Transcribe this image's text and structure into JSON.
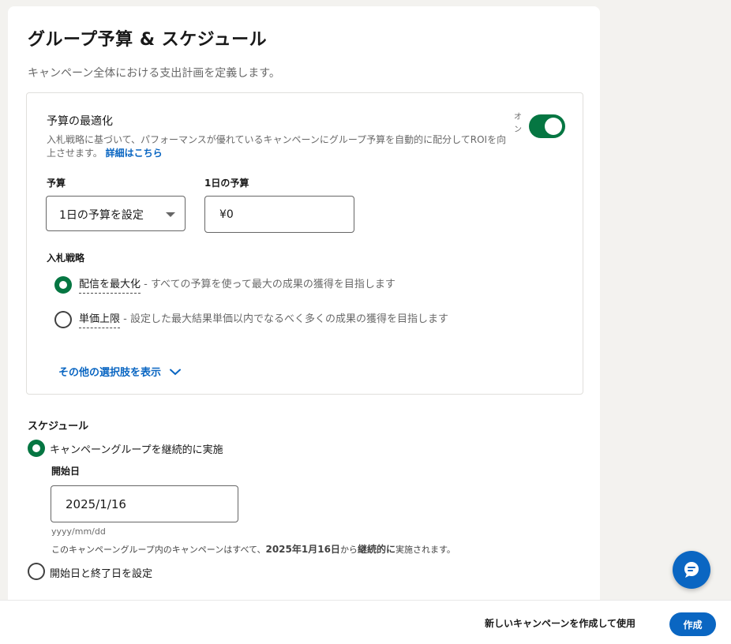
{
  "page": {
    "title": "グループ予算 & スケジュール",
    "subtitle": "キャンペーン全体における支出計画を定義します。"
  },
  "budget_optimization": {
    "heading": "予算の最適化",
    "description_line1": "入札戦略に基づいて、パフォーマンスが優れているキャンペーンにグループ予算を自動的に配分し",
    "description_line2": "てROIを向上させます。",
    "learn_more": "詳細はこちら",
    "toggle_label": "オン",
    "toggle_on": true
  },
  "budget": {
    "budget_label": "予算",
    "budget_select_value": "1日の予算を設定",
    "daily_budget_label": "1日の予算",
    "daily_budget_value": "¥0"
  },
  "bidding": {
    "label": "入札戦略",
    "options": [
      {
        "term": "配信を最大化",
        "description": " - すべての予算を使って最大の成果の獲得を目指します",
        "selected": true
      },
      {
        "term": "単価上限",
        "description": " - 設定した最大結果単価以内でなるべく多くの成果の獲得を目指します",
        "selected": false
      }
    ],
    "show_more": "その他の選択肢を表示"
  },
  "schedule": {
    "label": "スケジュール",
    "continuous_option": "キャンペーングループを継続的に実施",
    "start_date_label": "開始日",
    "start_date_value": "2025/1/16",
    "date_format_hint": "yyyy/mm/dd",
    "info_prefix": "このキャンペーングループ内のキャンペーンはすべて、",
    "info_date": "2025年1月16日",
    "info_middle": "から",
    "info_continuous": "継続的に",
    "info_suffix": "実施されます。",
    "start_end_option": "開始日と終了日を設定"
  },
  "footer": {
    "text": "新しいキャンペーンを作成して使用",
    "create_button": "作成"
  },
  "colors": {
    "accent_green": "#057642",
    "link_blue": "#0a66c2"
  }
}
